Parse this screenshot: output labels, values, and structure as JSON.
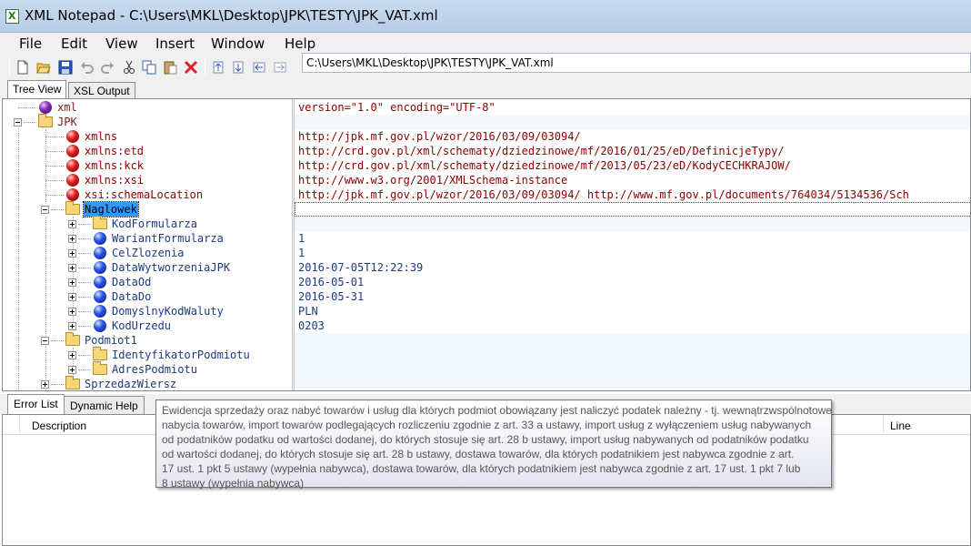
{
  "window": {
    "app_icon_letter": "X",
    "title": "XML Notepad - C:\\Users\\MKL\\Desktop\\JPK\\TESTY\\JPK_VAT.xml"
  },
  "menu": [
    "File",
    "Edit",
    "View",
    "Insert",
    "Window",
    "Help"
  ],
  "toolbar": {
    "buttons": [
      "new-icon",
      "open-icon",
      "save-icon",
      "undo-icon",
      "redo-icon",
      "cut-icon",
      "copy-icon",
      "paste-icon",
      "delete-icon",
      "nudge-up-icon",
      "nudge-down-icon",
      "nudge-left-icon",
      "nudge-right-icon"
    ],
    "path": "C:\\Users\\MKL\\Desktop\\JPK\\TESTY\\JPK_VAT.xml"
  },
  "tabs": {
    "tree_view": "Tree View",
    "xsl_output": "XSL Output"
  },
  "tree": {
    "nodes": [
      {
        "label": "xml",
        "kind": "pi",
        "value": "version=\"1.0\" encoding=\"UTF-8\""
      },
      {
        "label": "JPK",
        "kind": "element",
        "value": ""
      },
      {
        "label": "xmlns",
        "kind": "attribute",
        "value": "http://jpk.mf.gov.pl/wzor/2016/03/09/03094/"
      },
      {
        "label": "xmlns:etd",
        "kind": "attribute",
        "value": "http://crd.gov.pl/xml/schematy/dziedzinowe/mf/2016/01/25/eD/DefinicjeTypy/"
      },
      {
        "label": "xmlns:kck",
        "kind": "attribute",
        "value": "http://crd.gov.pl/xml/schematy/dziedzinowe/mf/2013/05/23/eD/KodyCECHKRAJOW/"
      },
      {
        "label": "xmlns:xsi",
        "kind": "attribute",
        "value": "http://www.w3.org/2001/XMLSchema-instance"
      },
      {
        "label": "xsi:schemaLocation",
        "kind": "attribute",
        "value": "http://jpk.mf.gov.pl/wzor/2016/03/09/03094/ http://www.mf.gov.pl/documents/764034/5134536/Sch"
      },
      {
        "label": "Naglowek",
        "kind": "element",
        "value": "",
        "selected": true
      },
      {
        "label": "KodFormularza",
        "kind": "element",
        "value": ""
      },
      {
        "label": "WariantFormularza",
        "kind": "leaf",
        "value": "1"
      },
      {
        "label": "CelZlozenia",
        "kind": "leaf",
        "value": "1"
      },
      {
        "label": "DataWytworzeniaJPK",
        "kind": "leaf",
        "value": "2016-07-05T12:22:39"
      },
      {
        "label": "DataOd",
        "kind": "leaf",
        "value": "2016-05-01"
      },
      {
        "label": "DataDo",
        "kind": "leaf",
        "value": "2016-05-31"
      },
      {
        "label": "DomyslnyKodWaluty",
        "kind": "leaf",
        "value": "PLN"
      },
      {
        "label": "KodUrzedu",
        "kind": "leaf",
        "value": "0203"
      },
      {
        "label": "Podmiot1",
        "kind": "element",
        "value": ""
      },
      {
        "label": "IdentyfikatorPodmiotu",
        "kind": "element",
        "value": ""
      },
      {
        "label": "AdresPodmiotu",
        "kind": "element",
        "value": ""
      },
      {
        "label": "SprzedazWiersz",
        "kind": "element",
        "value": ""
      }
    ]
  },
  "bottom_tabs": {
    "error_list": "Error List",
    "dynamic_help": "Dynamic Help"
  },
  "error_list": {
    "col_description": "Description",
    "col_line": "Line"
  },
  "tooltip": {
    "lines": [
      "Ewidencja sprzedaży oraz nabyć towarów i usług dla których podmiot obowiązany jest naliczyć podatek należny - tj. wewnątrzwspólnotowe",
      "nabycia towarów, import towarów podlegających rozliczeniu zgodnie z art. 33 a ustawy, import usług z wyłączeniem usług nabywanych",
      "od podatników podatku od wartości dodanej, do których stosuje się art. 28 b ustawy, import usług nabywanych od podatników podatku",
      "od wartości dodanej, do których stosuje się art. 28 b ustawy, dostawa towarów, dla których podatnikiem jest nabywca zgodnie z art.",
      "17 ust. 1 pkt 5 ustawy (wypełnia nabywca), dostawa towarów, dla których podatnikiem jest nabywca zgodnie z art. 17 ust. 1 pkt 7 lub",
      "8 ustawy (wypełnia nabywca)"
    ]
  }
}
